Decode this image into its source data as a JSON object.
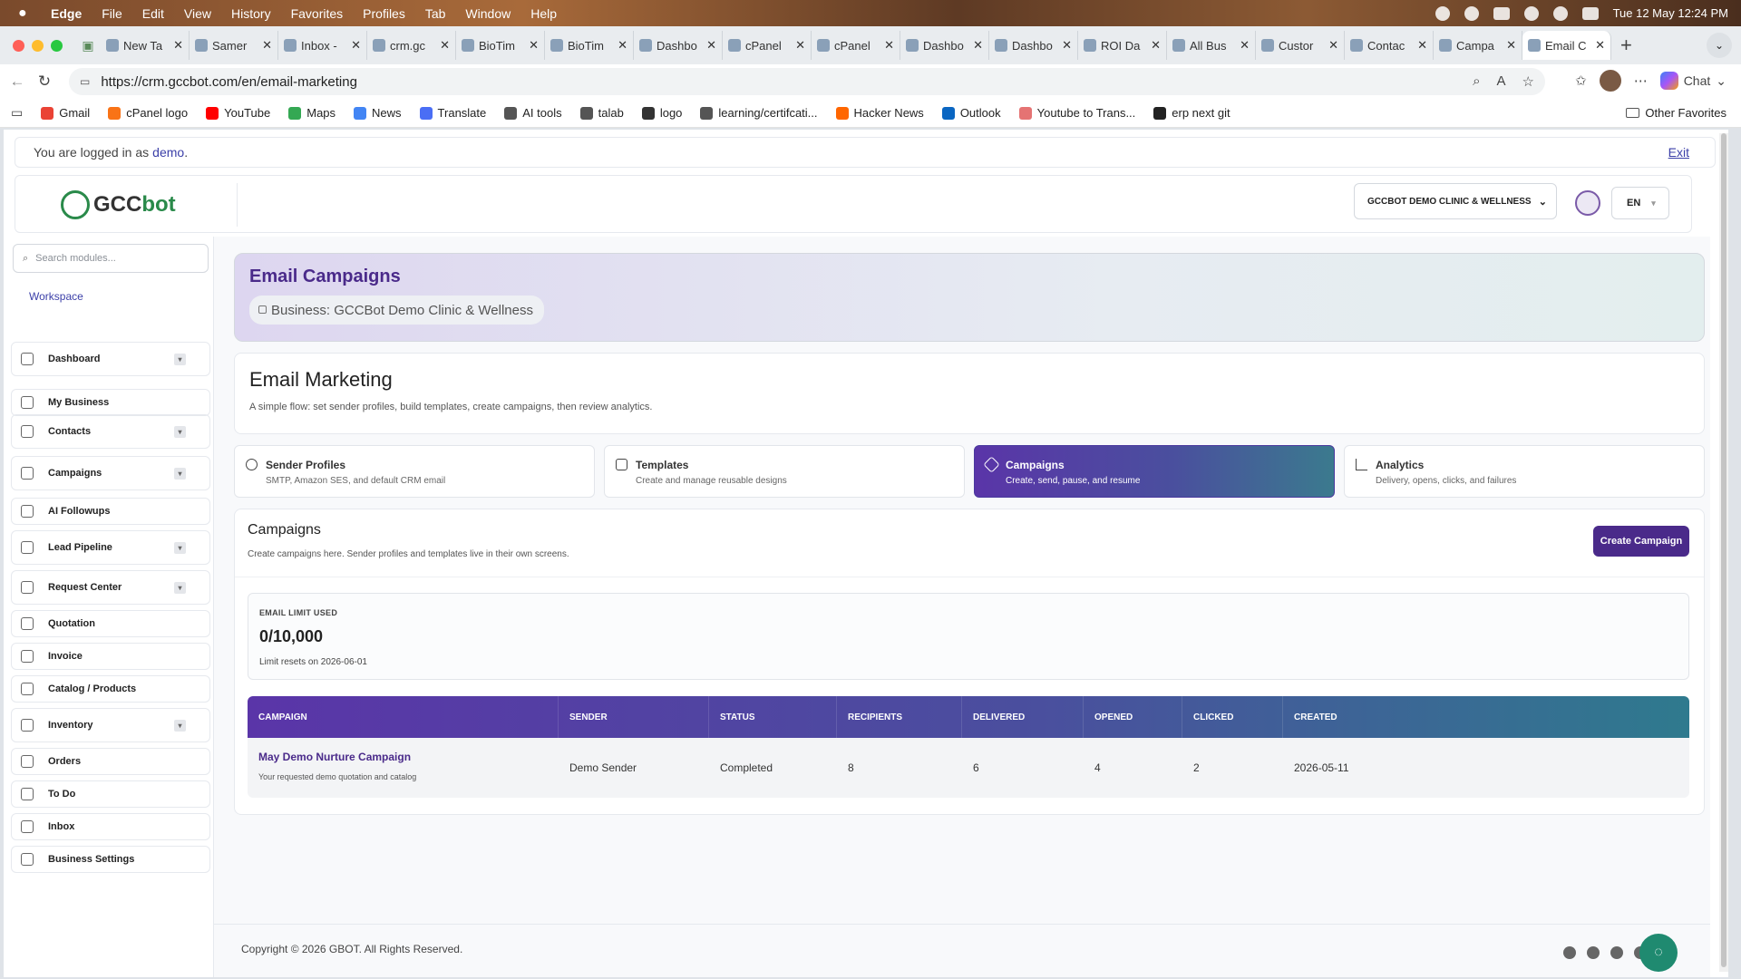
{
  "menubar": {
    "app": "Edge",
    "items": [
      "File",
      "Edit",
      "View",
      "History",
      "Favorites",
      "Profiles",
      "Tab",
      "Window",
      "Help"
    ],
    "clock": "Tue 12 May  12:24 PM"
  },
  "tabs": [
    {
      "label": "New Ta"
    },
    {
      "label": "Samer"
    },
    {
      "label": "Inbox -"
    },
    {
      "label": "crm.gc"
    },
    {
      "label": "BioTim"
    },
    {
      "label": "BioTim"
    },
    {
      "label": "Dashbo"
    },
    {
      "label": "cPanel"
    },
    {
      "label": "cPanel"
    },
    {
      "label": "Dashbo"
    },
    {
      "label": "Dashbo"
    },
    {
      "label": "ROI Da"
    },
    {
      "label": "All Bus"
    },
    {
      "label": "Custor"
    },
    {
      "label": "Contac"
    },
    {
      "label": "Campa"
    },
    {
      "label": "Email C"
    }
  ],
  "address": {
    "url": "https://crm.gccbot.com/en/email-marketing",
    "chat_label": "Chat"
  },
  "bookmarks": [
    "Gmail",
    "cPanel logo",
    "YouTube",
    "Maps",
    "News",
    "Translate",
    "AI tools",
    "talab",
    "logo",
    "learning/certifcati...",
    "Hacker News",
    "Outlook",
    "Youtube to Trans...",
    "erp next git"
  ],
  "bookmarks_other": "Other Favorites",
  "login": {
    "prefix": "You are logged in as",
    "user": "demo",
    "suffix": ".",
    "exit": "Exit"
  },
  "header": {
    "logo_g": "G",
    "logo_text": "GCC",
    "logo_bot": "bot",
    "business_select": "GCCBOT DEMO CLINIC & WELLNESS",
    "lang": "EN"
  },
  "sidebar": {
    "search_placeholder": "Search modules...",
    "workspace": "Workspace",
    "items": [
      {
        "label": "Dashboard"
      },
      {
        "label": "My Business"
      },
      {
        "label": "Contacts"
      },
      {
        "label": "Campaigns"
      },
      {
        "label": "AI Followups"
      },
      {
        "label": "Lead Pipeline"
      },
      {
        "label": "Request Center"
      },
      {
        "label": "Quotation"
      },
      {
        "label": "Invoice"
      },
      {
        "label": "Catalog / Products"
      },
      {
        "label": "Inventory"
      },
      {
        "label": "Orders"
      },
      {
        "label": "To Do"
      },
      {
        "label": "Inbox"
      },
      {
        "label": "Business Settings"
      }
    ]
  },
  "hero": {
    "title": "Email Campaigns",
    "business": "Business: GCCBot Demo Clinic & Wellness"
  },
  "email_marketing": {
    "title": "Email Marketing",
    "subtitle": "A simple flow: set sender profiles, build templates, create campaigns, then review analytics."
  },
  "sections": [
    {
      "title": "Sender Profiles",
      "sub": "SMTP, Amazon SES, and default CRM email"
    },
    {
      "title": "Templates",
      "sub": "Create and manage reusable designs"
    },
    {
      "title": "Campaigns",
      "sub": "Create, send, pause, and resume"
    },
    {
      "title": "Analytics",
      "sub": "Delivery, opens, clicks, and failures"
    }
  ],
  "campaigns": {
    "title": "Campaigns",
    "subtitle": "Create campaigns here. Sender profiles and templates live in their own screens.",
    "create_button": "Create Campaign",
    "limit_label": "EMAIL LIMIT USED",
    "limit_value": "0/10,000",
    "limit_reset": "Limit resets on 2026-06-01",
    "columns": [
      "CAMPAIGN",
      "SENDER",
      "STATUS",
      "RECIPIENTS",
      "DELIVERED",
      "OPENED",
      "CLICKED",
      "CREATED"
    ],
    "rows": [
      {
        "name": "May Demo Nurture Campaign",
        "subject": "Your requested demo quotation and catalog",
        "sender": "Demo Sender",
        "status": "Completed",
        "recipients": "8",
        "delivered": "6",
        "opened": "4",
        "clicked": "2",
        "created": "2026-05-11"
      }
    ]
  },
  "footer": {
    "copyright": "Copyright © 2026 GBOT. All Rights Reserved."
  },
  "colors": {
    "brand_purple": "#4a2a8a",
    "brand_green": "#2a8a4a",
    "accent_teal": "#1f8a70"
  }
}
